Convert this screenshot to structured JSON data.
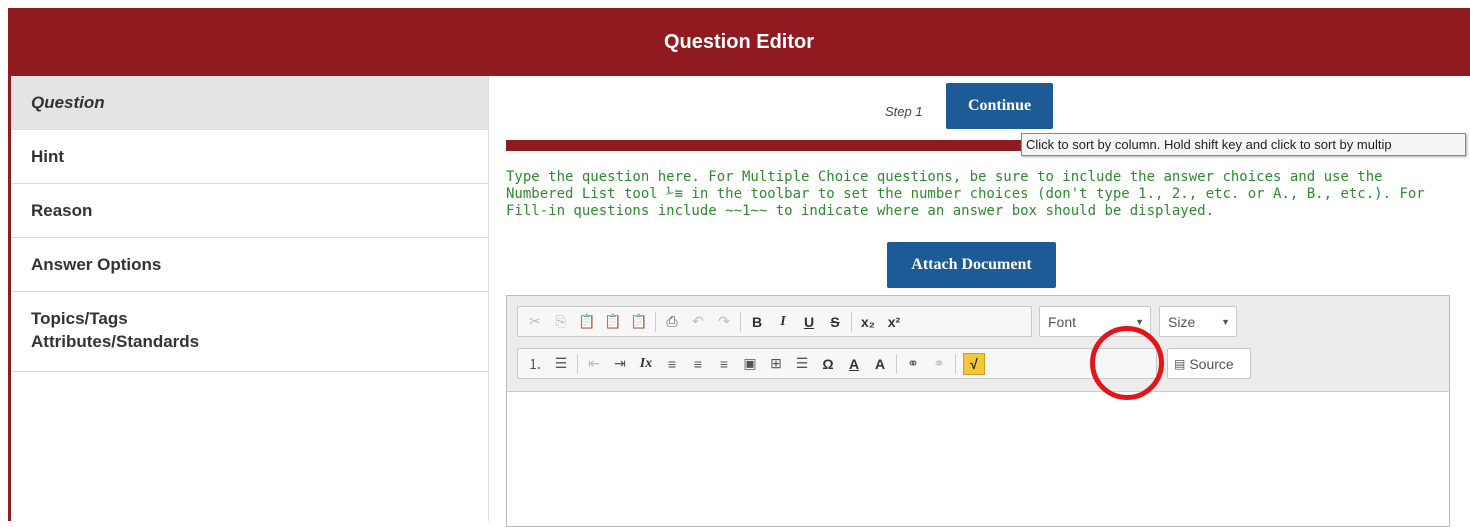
{
  "header": {
    "title": "Question Editor"
  },
  "sidebar": {
    "items": [
      {
        "label": "Question"
      },
      {
        "label": "Hint"
      },
      {
        "label": "Reason"
      },
      {
        "label": "Answer Options"
      },
      {
        "label": "Topics/Tags"
      },
      {
        "label": "Attributes/Standards"
      }
    ]
  },
  "main": {
    "step_label": "Step 1",
    "continue_label": "Continue",
    "tooltip": "Click to sort by column.  Hold shift key and click to sort by multip",
    "instructions": "Type the question here. For Multiple Choice questions, be sure to include the answer choices and use the Numbered List tool ⅟≡ in the toolbar to set the number choices (don't type 1., 2., etc. or A., B., etc.). For Fill-in questions include ~~1~~ to indicate where an answer box should be displayed.",
    "attach_label": "Attach Document"
  },
  "editor": {
    "font_combo": "Font",
    "size_combo": "Size",
    "source_label": "Source",
    "toolbar_glyphs": {
      "bold": "B",
      "italic": "I",
      "underline": "U",
      "strike": "S",
      "subscript": "x₂",
      "superscript": "x²",
      "omega": "Ω",
      "text_color": "A",
      "bg_color": "A",
      "sqrt": "√"
    }
  },
  "colors": {
    "brand": "#8f1b20",
    "button": "#1d5b96",
    "instructions": "#2e8b2e",
    "highlight": "#e5141b"
  }
}
